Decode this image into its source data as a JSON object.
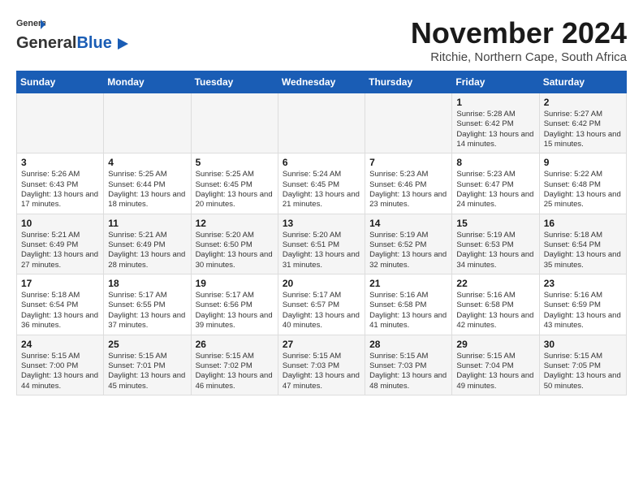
{
  "header": {
    "logo_general": "General",
    "logo_blue": "Blue",
    "month_title": "November 2024",
    "subtitle": "Ritchie, Northern Cape, South Africa"
  },
  "weekdays": [
    "Sunday",
    "Monday",
    "Tuesday",
    "Wednesday",
    "Thursday",
    "Friday",
    "Saturday"
  ],
  "weeks": [
    [
      {
        "day": "",
        "text": ""
      },
      {
        "day": "",
        "text": ""
      },
      {
        "day": "",
        "text": ""
      },
      {
        "day": "",
        "text": ""
      },
      {
        "day": "",
        "text": ""
      },
      {
        "day": "1",
        "text": "Sunrise: 5:28 AM\nSunset: 6:42 PM\nDaylight: 13 hours and 14 minutes."
      },
      {
        "day": "2",
        "text": "Sunrise: 5:27 AM\nSunset: 6:42 PM\nDaylight: 13 hours and 15 minutes."
      }
    ],
    [
      {
        "day": "3",
        "text": "Sunrise: 5:26 AM\nSunset: 6:43 PM\nDaylight: 13 hours and 17 minutes."
      },
      {
        "day": "4",
        "text": "Sunrise: 5:25 AM\nSunset: 6:44 PM\nDaylight: 13 hours and 18 minutes."
      },
      {
        "day": "5",
        "text": "Sunrise: 5:25 AM\nSunset: 6:45 PM\nDaylight: 13 hours and 20 minutes."
      },
      {
        "day": "6",
        "text": "Sunrise: 5:24 AM\nSunset: 6:45 PM\nDaylight: 13 hours and 21 minutes."
      },
      {
        "day": "7",
        "text": "Sunrise: 5:23 AM\nSunset: 6:46 PM\nDaylight: 13 hours and 23 minutes."
      },
      {
        "day": "8",
        "text": "Sunrise: 5:23 AM\nSunset: 6:47 PM\nDaylight: 13 hours and 24 minutes."
      },
      {
        "day": "9",
        "text": "Sunrise: 5:22 AM\nSunset: 6:48 PM\nDaylight: 13 hours and 25 minutes."
      }
    ],
    [
      {
        "day": "10",
        "text": "Sunrise: 5:21 AM\nSunset: 6:49 PM\nDaylight: 13 hours and 27 minutes."
      },
      {
        "day": "11",
        "text": "Sunrise: 5:21 AM\nSunset: 6:49 PM\nDaylight: 13 hours and 28 minutes."
      },
      {
        "day": "12",
        "text": "Sunrise: 5:20 AM\nSunset: 6:50 PM\nDaylight: 13 hours and 30 minutes."
      },
      {
        "day": "13",
        "text": "Sunrise: 5:20 AM\nSunset: 6:51 PM\nDaylight: 13 hours and 31 minutes."
      },
      {
        "day": "14",
        "text": "Sunrise: 5:19 AM\nSunset: 6:52 PM\nDaylight: 13 hours and 32 minutes."
      },
      {
        "day": "15",
        "text": "Sunrise: 5:19 AM\nSunset: 6:53 PM\nDaylight: 13 hours and 34 minutes."
      },
      {
        "day": "16",
        "text": "Sunrise: 5:18 AM\nSunset: 6:54 PM\nDaylight: 13 hours and 35 minutes."
      }
    ],
    [
      {
        "day": "17",
        "text": "Sunrise: 5:18 AM\nSunset: 6:54 PM\nDaylight: 13 hours and 36 minutes."
      },
      {
        "day": "18",
        "text": "Sunrise: 5:17 AM\nSunset: 6:55 PM\nDaylight: 13 hours and 37 minutes."
      },
      {
        "day": "19",
        "text": "Sunrise: 5:17 AM\nSunset: 6:56 PM\nDaylight: 13 hours and 39 minutes."
      },
      {
        "day": "20",
        "text": "Sunrise: 5:17 AM\nSunset: 6:57 PM\nDaylight: 13 hours and 40 minutes."
      },
      {
        "day": "21",
        "text": "Sunrise: 5:16 AM\nSunset: 6:58 PM\nDaylight: 13 hours and 41 minutes."
      },
      {
        "day": "22",
        "text": "Sunrise: 5:16 AM\nSunset: 6:58 PM\nDaylight: 13 hours and 42 minutes."
      },
      {
        "day": "23",
        "text": "Sunrise: 5:16 AM\nSunset: 6:59 PM\nDaylight: 13 hours and 43 minutes."
      }
    ],
    [
      {
        "day": "24",
        "text": "Sunrise: 5:15 AM\nSunset: 7:00 PM\nDaylight: 13 hours and 44 minutes."
      },
      {
        "day": "25",
        "text": "Sunrise: 5:15 AM\nSunset: 7:01 PM\nDaylight: 13 hours and 45 minutes."
      },
      {
        "day": "26",
        "text": "Sunrise: 5:15 AM\nSunset: 7:02 PM\nDaylight: 13 hours and 46 minutes."
      },
      {
        "day": "27",
        "text": "Sunrise: 5:15 AM\nSunset: 7:03 PM\nDaylight: 13 hours and 47 minutes."
      },
      {
        "day": "28",
        "text": "Sunrise: 5:15 AM\nSunset: 7:03 PM\nDaylight: 13 hours and 48 minutes."
      },
      {
        "day": "29",
        "text": "Sunrise: 5:15 AM\nSunset: 7:04 PM\nDaylight: 13 hours and 49 minutes."
      },
      {
        "day": "30",
        "text": "Sunrise: 5:15 AM\nSunset: 7:05 PM\nDaylight: 13 hours and 50 minutes."
      }
    ]
  ]
}
